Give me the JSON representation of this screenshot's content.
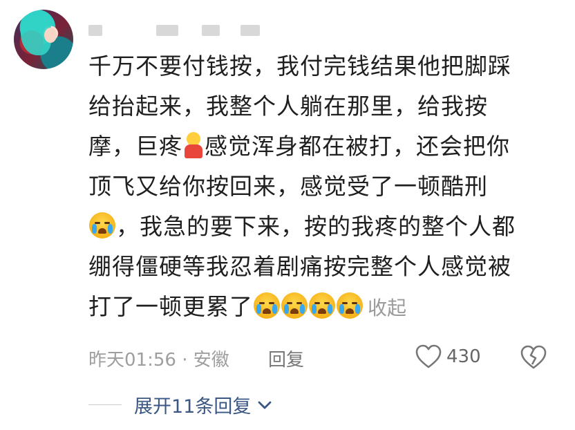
{
  "comment": {
    "lines": [
      "千万不要付钱按，我付完钱结果他把脚踩",
      "给抬起来，我整个人躺在那里，给我按",
      "摩，巨疼",
      "感觉浑身都在被打，还会把你",
      "顶飞又给你按回来，感觉受了一顿酷刑",
      "，我急的要下来，按的我疼的整个人都",
      "绷得僵硬等我忍着剧痛按完整个人感觉被",
      "打了一顿更累了"
    ],
    "collapse_label": "收起"
  },
  "meta": {
    "time_location": "昨天01:56 · 安徽",
    "reply_label": "回复"
  },
  "actions": {
    "like_count": "430"
  },
  "expand_replies": {
    "label": "展开11条回复"
  },
  "icons": {
    "like": "heart-outline-icon",
    "dislike": "broken-heart-icon",
    "crying": "crying-emoji-icon",
    "person": "person-emoji-icon",
    "chevron": "chevron-down-icon"
  },
  "colors": {
    "text": "#1f1f1f",
    "meta": "#9e9e9e",
    "link": "#3a5683"
  }
}
